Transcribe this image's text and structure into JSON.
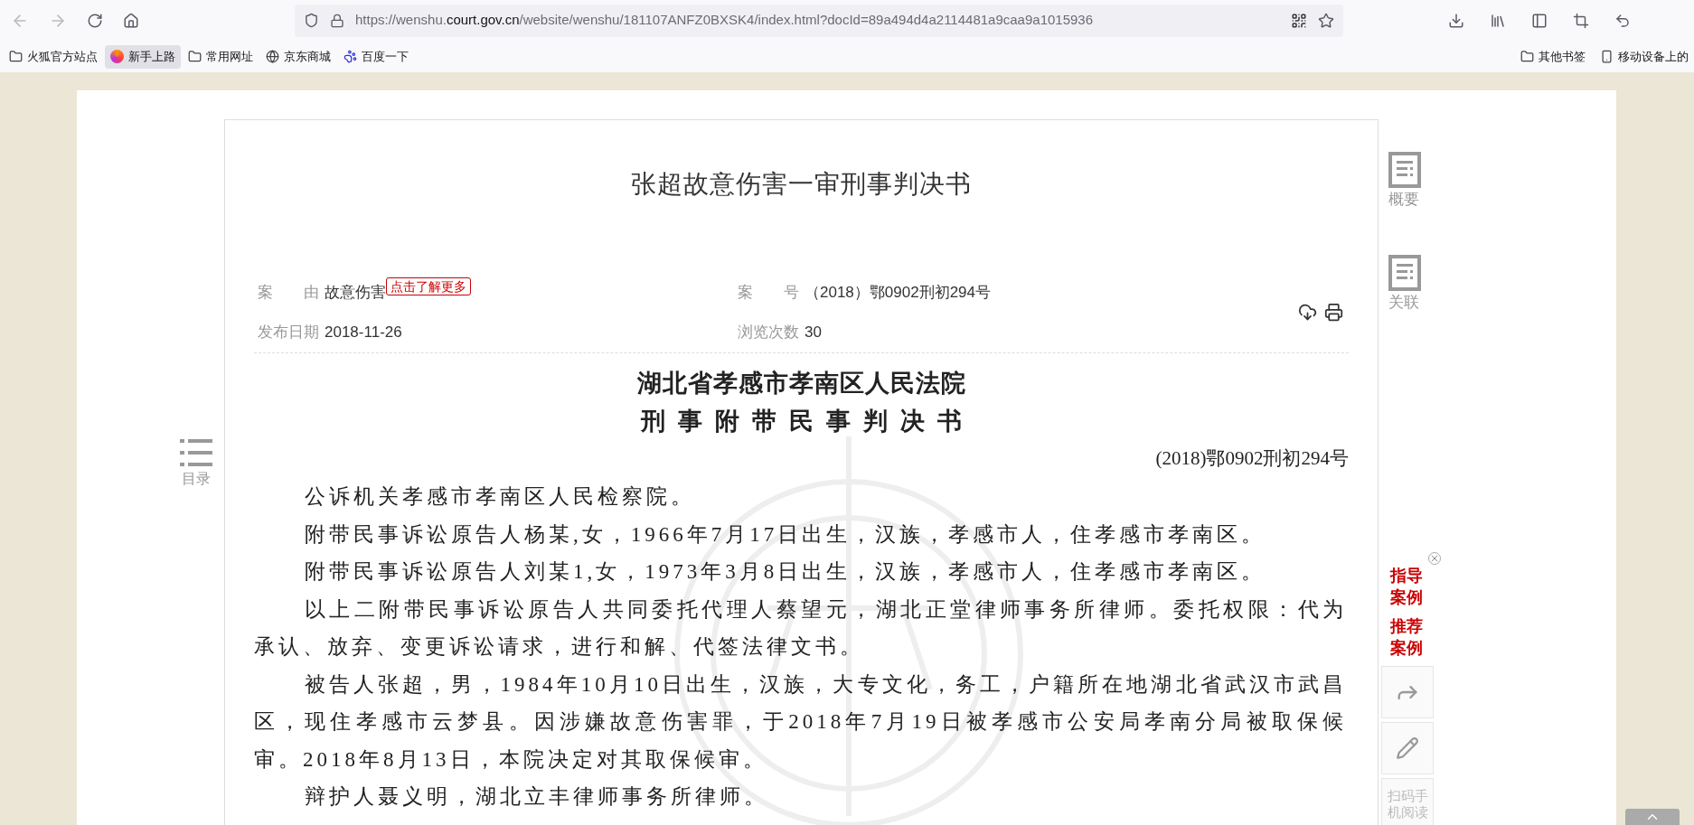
{
  "browser": {
    "url": {
      "prefix": "https://wenshu.",
      "domain": "court.gov.cn",
      "path": "/website/wenshu/181107ANFZ0BXSK4/index.html?docId=89a494d4a2114481a9caa9a1015936"
    },
    "bookmarks": [
      {
        "kind": "folder",
        "label": "火狐官方站点",
        "selected": false
      },
      {
        "kind": "firefox",
        "label": "新手上路",
        "selected": true
      },
      {
        "kind": "folder",
        "label": "常用网址",
        "selected": false
      },
      {
        "kind": "globe",
        "label": "京东商城",
        "selected": false
      },
      {
        "kind": "paw",
        "label": "百度一下",
        "selected": false
      }
    ],
    "other_bookmarks": [
      {
        "kind": "folder",
        "label": "其他书签",
        "selected": false
      },
      {
        "kind": "phone",
        "label": "移动设备上的",
        "selected": false
      }
    ]
  },
  "document": {
    "title": "张超故意伤害一审刑事判决书",
    "meta": [
      {
        "label": "案　　由",
        "value": "故意伤害",
        "tag": "点击了解更多"
      },
      {
        "label": "案　　号",
        "value": "（2018）鄂0902刑初294号"
      },
      {
        "label": "发布日期",
        "value": "2018-11-26"
      },
      {
        "label": "浏览次数",
        "value": "30"
      }
    ],
    "court": "湖北省孝感市孝南区人民法院",
    "doc_type": "刑事附带民事判决书",
    "case_number": "(2018)鄂0902刑初294号",
    "paragraphs": [
      "公诉机关孝感市孝南区人民检察院。",
      "附带民事诉讼原告人杨某,女，1966年7月17日出生，汉族，孝感市人，住孝感市孝南区。",
      "附带民事诉讼原告人刘某1,女，1973年3月8日出生，汉族，孝感市人，住孝感市孝南区。",
      "以上二附带民事诉讼原告人共同委托代理人蔡望元，湖北正堂律师事务所律师。委托权限：代为承认、放弃、变更诉讼请求，进行和解、代签法律文书。",
      "被告人张超，男，1984年10月10日出生，汉族，大专文化，务工，户籍所在地湖北省武汉市武昌区，现住孝感市云梦县。因涉嫌故意伤害罪，于2018年7月19日被孝感市公安局孝南分局被取保候审。2018年8月13日，本院决定对其取保候审。",
      "辩护人聂义明，湖北立丰律师事务所律师。"
    ]
  },
  "toc": {
    "label": "目录"
  },
  "side_tools": [
    {
      "label": "概要"
    },
    {
      "label": "关联"
    }
  ],
  "promo_links": [
    "指导案例",
    "推荐案例"
  ],
  "qr_read_label": "扫码手机阅读"
}
